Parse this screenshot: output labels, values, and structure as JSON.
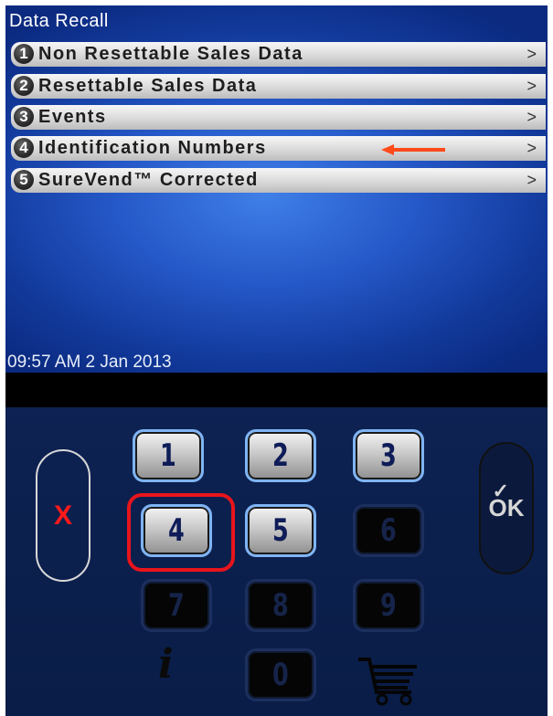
{
  "screen": {
    "title": "Data Recall",
    "timestamp": "09:57 AM 2 Jan 2013"
  },
  "menu": {
    "items": [
      {
        "number": "1",
        "label": "Non Resettable Sales Data",
        "chevron": ">"
      },
      {
        "number": "2",
        "label": "Resettable Sales Data",
        "chevron": ">"
      },
      {
        "number": "3",
        "label": "Events",
        "chevron": ">"
      },
      {
        "number": "4",
        "label": "Identification Numbers",
        "chevron": ">"
      },
      {
        "number": "5",
        "label": "SureVend™ Corrected",
        "chevron": ">"
      }
    ]
  },
  "keypad": {
    "cancel_label": "X",
    "ok_label": "OK",
    "ok_check": "✓",
    "keys": [
      "1",
      "2",
      "3",
      "4",
      "5",
      "6",
      "7",
      "8",
      "9",
      "0"
    ],
    "info_label": "i"
  },
  "colors": {
    "highlight": "#e8141c",
    "arrow": "#ff4a1a",
    "cancel": "#ff1a1a"
  }
}
